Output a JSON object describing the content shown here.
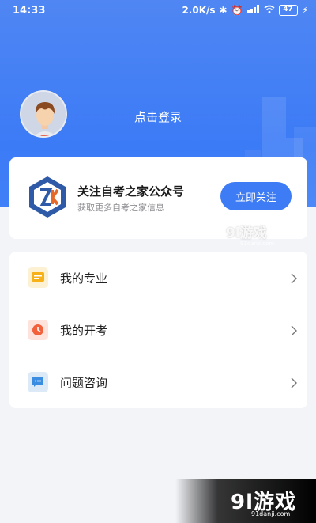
{
  "statusbar": {
    "time": "14:33",
    "network_speed": "2.0K/s",
    "battery": "47"
  },
  "profile": {
    "login_label": "点击登录"
  },
  "follow_card": {
    "title": "关注自考之家公众号",
    "subtitle": "获取更多自考之家信息",
    "button_label": "立即关注"
  },
  "menu": {
    "items": [
      {
        "label": "我的专业",
        "icon": "book-icon",
        "color": "#f7b21a",
        "bg": "#fdf1d4"
      },
      {
        "label": "我的开考",
        "icon": "clock-icon",
        "color": "#f2613b",
        "bg": "#fde3dc"
      },
      {
        "label": "问题咨询",
        "icon": "chat-icon",
        "color": "#3a8de0",
        "bg": "#dceaf8"
      }
    ]
  },
  "watermark": {
    "brand": "9l游戏",
    "url": "91danji.com"
  },
  "colors": {
    "primary": "#3d7cf4",
    "background": "#f3f4f8"
  }
}
